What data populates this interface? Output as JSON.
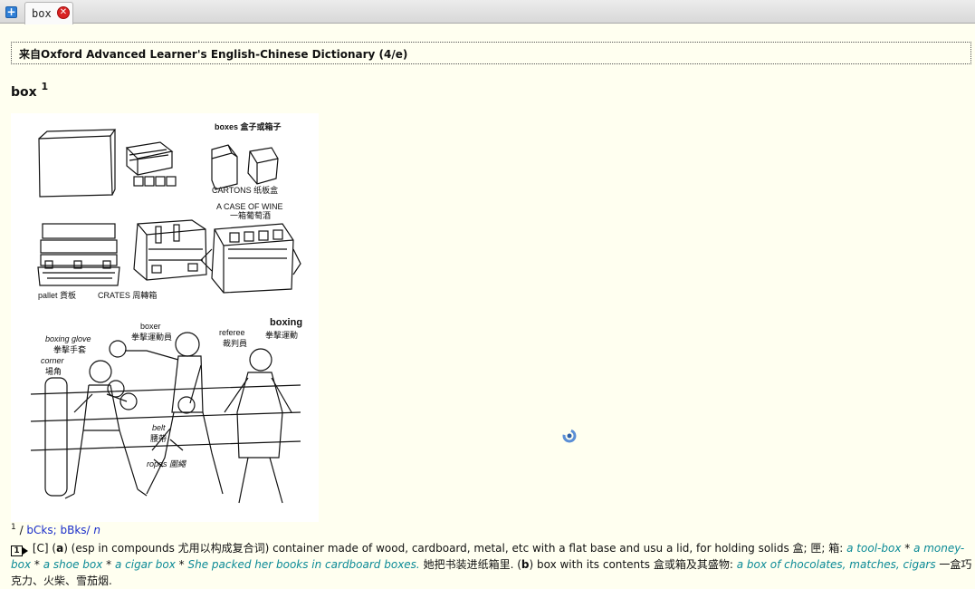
{
  "tabs": [
    {
      "label": "box"
    }
  ],
  "source_header": "来自Oxford Advanced Learner's English-Chinese Dictionary (4/e)",
  "entry": {
    "headword": "box",
    "homograph": "1",
    "pron_num": "1",
    "phonetic": "bCks; bBks",
    "pos": "n"
  },
  "illustration": {
    "boxes": "boxes  盒子或箱子",
    "cartons": "CARTONS  纸板盒",
    "case_wine": "A CASE OF WINE",
    "case_wine_cn": "一箱葡萄酒",
    "pallet": "pallet 貨板",
    "crates": "CRATES  周轉箱",
    "boxing": "boxing",
    "boxing_cn": "拳擊運動",
    "boxer": "boxer",
    "boxer_cn": "拳擊運動員",
    "referee": "referee",
    "referee_cn": "裁判員",
    "boxing_glove": "boxing glove",
    "boxing_glove_cn": "拳擊手套",
    "corner": "corner",
    "corner_cn": "場角",
    "belt": "belt",
    "belt_cn": "腰帶",
    "ropes": "ropes 圍繩"
  },
  "definition": {
    "sense_num": "1",
    "grammar": "[C] (",
    "sub_a": "a",
    "text_a": ") (esp in compounds 尤用以构成复合词) container made of wood, cardboard, metal, etc with a flat base and usu a lid, for holding solids 盒; 匣; 箱: ",
    "ex1": "a tool-box",
    "sep1": " * ",
    "ex2": "a money-box",
    "sep2": " * ",
    "ex3": "a shoe box",
    "sep3": " * ",
    "ex4": "a cigar box",
    "sep4": " * ",
    "ex5": "She packed her books in cardboard boxes.",
    "tr5": " 她把书装进纸箱里. (",
    "sub_b": "b",
    "text_b": ") box with its contents 盒或箱及其盛物: ",
    "ex6": "a box of chocolates, matches, cigars",
    "tr6": " 一盒巧克力、火柴、雪茄烟."
  }
}
